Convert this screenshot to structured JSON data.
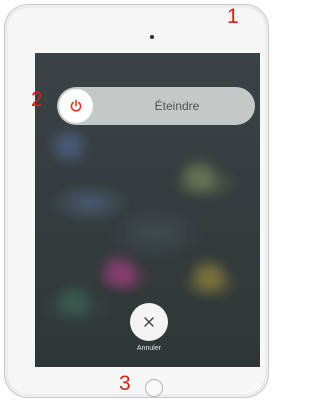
{
  "annotations": {
    "marker_1": "1",
    "marker_2": "2",
    "marker_3": "3",
    "color": "#d3201c"
  },
  "power_menu": {
    "slider_label": "Éteindre",
    "power_icon": "power-icon",
    "power_icon_color": "#e0341e",
    "cancel_label": "Annuler",
    "cancel_icon": "close-icon"
  }
}
